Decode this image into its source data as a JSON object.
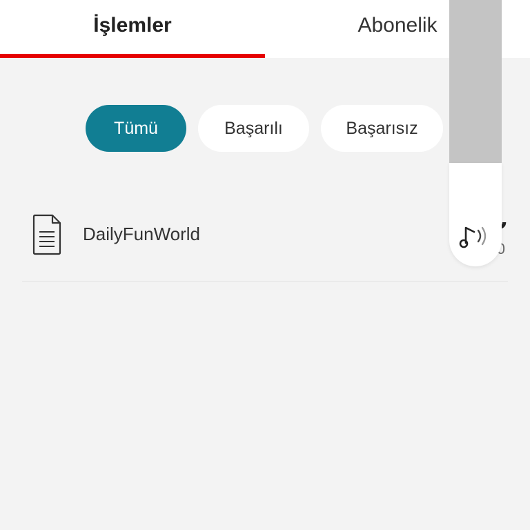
{
  "tabs": [
    {
      "label": "İşlemler",
      "active": true
    },
    {
      "label": "Abonelik",
      "active": false
    }
  ],
  "filters": [
    {
      "label": "Tümü",
      "selected": true
    },
    {
      "label": "Başarılı",
      "selected": false
    },
    {
      "label": "Başarısız",
      "selected": false
    }
  ],
  "transactions": [
    {
      "title": "DailyFunWorld",
      "amount_visible": "₺",
      "date_visible": "11.0",
      "icon": "document-icon"
    }
  ],
  "overlay": {
    "icon": "music-sound-icon"
  },
  "colors": {
    "accent_red": "#e60000",
    "chip_selected": "#117e93",
    "background": "#f3f3f3"
  }
}
